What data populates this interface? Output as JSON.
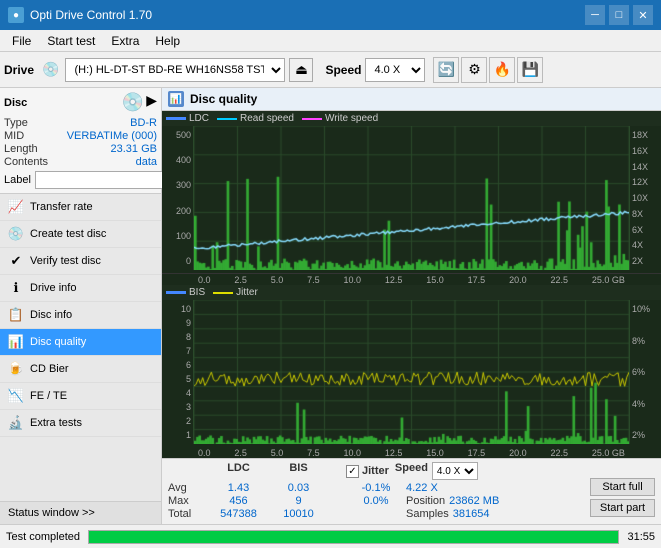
{
  "app": {
    "title": "Opti Drive Control 1.70",
    "icon": "●"
  },
  "titlebar": {
    "minimize": "─",
    "maximize": "□",
    "close": "✕"
  },
  "menu": {
    "items": [
      "File",
      "Start test",
      "Extra",
      "Help"
    ]
  },
  "toolbar": {
    "drive_label": "Drive",
    "drive_value": "(H:)  HL-DT-ST BD-RE  WH16NS58 TST4",
    "speed_label": "Speed",
    "speed_value": "4.0 X"
  },
  "disc": {
    "title": "Disc",
    "type_label": "Type",
    "type_val": "BD-R",
    "mid_label": "MID",
    "mid_val": "VERBATIMe (000)",
    "length_label": "Length",
    "length_val": "23.31 GB",
    "contents_label": "Contents",
    "contents_val": "data",
    "label_label": "Label",
    "label_val": ""
  },
  "nav": {
    "items": [
      {
        "id": "transfer-rate",
        "label": "Transfer rate",
        "icon": "📈"
      },
      {
        "id": "create-test-disc",
        "label": "Create test disc",
        "icon": "💿"
      },
      {
        "id": "verify-test-disc",
        "label": "Verify test disc",
        "icon": "✔"
      },
      {
        "id": "drive-info",
        "label": "Drive info",
        "icon": "ℹ"
      },
      {
        "id": "disc-info",
        "label": "Disc info",
        "icon": "📋"
      },
      {
        "id": "disc-quality",
        "label": "Disc quality",
        "icon": "📊",
        "active": true
      },
      {
        "id": "cd-bier",
        "label": "CD Bier",
        "icon": "🍺"
      },
      {
        "id": "fe-te",
        "label": "FE / TE",
        "icon": "📉"
      },
      {
        "id": "extra-tests",
        "label": "Extra tests",
        "icon": "🔬"
      }
    ]
  },
  "status_window": {
    "label": "Status window >> "
  },
  "disc_quality": {
    "title": "Disc quality",
    "chart1": {
      "legend": [
        "LDC",
        "Read speed",
        "Write speed"
      ],
      "y_labels": [
        "500",
        "400",
        "300",
        "200",
        "100",
        "0"
      ],
      "y_labels_right": [
        "18X",
        "16X",
        "14X",
        "12X",
        "10X",
        "8X",
        "6X",
        "4X",
        "2X"
      ],
      "x_labels": [
        "0.0",
        "2.5",
        "5.0",
        "7.5",
        "10.0",
        "12.5",
        "15.0",
        "17.5",
        "20.0",
        "22.5",
        "25.0 GB"
      ]
    },
    "chart2": {
      "legend": [
        "BIS",
        "Jitter"
      ],
      "y_labels": [
        "10",
        "9",
        "8",
        "7",
        "6",
        "5",
        "4",
        "3",
        "2",
        "1"
      ],
      "y_labels_right": [
        "10%",
        "8%",
        "6%",
        "4%",
        "2%"
      ],
      "x_labels": [
        "0.0",
        "2.5",
        "5.0",
        "7.5",
        "10.0",
        "12.5",
        "15.0",
        "17.5",
        "20.0",
        "22.5",
        "25.0 GB"
      ]
    }
  },
  "stats": {
    "columns": [
      "LDC",
      "BIS",
      "",
      "Jitter",
      "Speed",
      ""
    ],
    "avg_label": "Avg",
    "avg_ldc": "1.43",
    "avg_bis": "0.03",
    "avg_jitter": "-0.1%",
    "avg_speed": "4.22 X",
    "speed_dropdown": "4.0 X",
    "max_label": "Max",
    "max_ldc": "456",
    "max_bis": "9",
    "max_jitter": "0.0%",
    "pos_label": "Position",
    "pos_val": "23862 MB",
    "total_label": "Total",
    "total_ldc": "547388",
    "total_bis": "10010",
    "samples_label": "Samples",
    "samples_val": "381654",
    "jitter_checked": true,
    "jitter_label": "Jitter",
    "btn_start_full": "Start full",
    "btn_start_part": "Start part"
  },
  "statusbar": {
    "text": "Test completed",
    "progress": 100,
    "time": "31:55"
  }
}
